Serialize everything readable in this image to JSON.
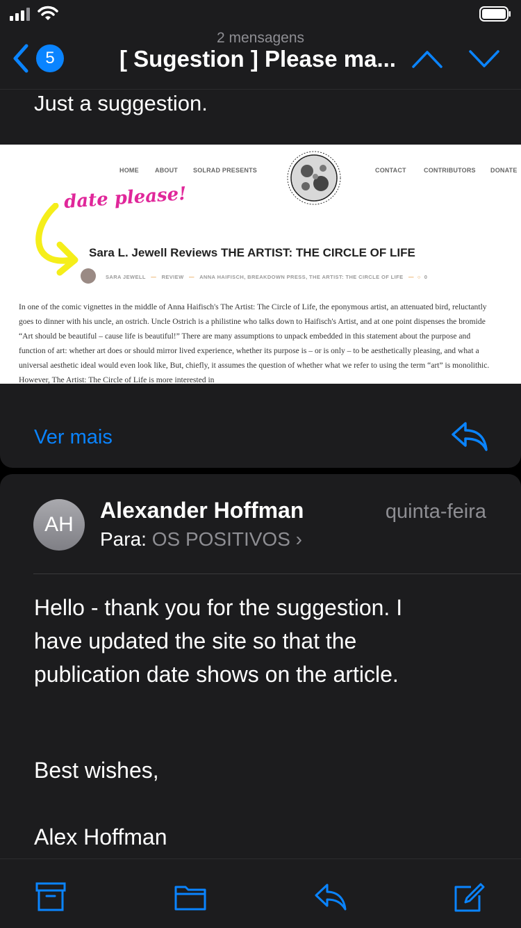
{
  "status_bar": {
    "signal_icon": "signal-icon",
    "wifi_icon": "wifi-icon",
    "battery_icon": "battery-icon"
  },
  "nav": {
    "message_count": "2 mensagens",
    "unread_badge": "5",
    "title": "[ Sugestion ] Please ma...",
    "back_icon": "chevron-left-icon",
    "prev_icon": "chevron-up-icon",
    "next_icon": "chevron-down-icon"
  },
  "first_message": {
    "text": "Just a suggestion.",
    "more_label": "Ver mais",
    "reply_icon": "reply-icon",
    "attachment": {
      "nav_items": [
        "HOME",
        "ABOUT",
        "SOLRAD PRESENTS",
        "CONTACT",
        "CONTRIBUTORS",
        "DONATE"
      ],
      "annotation": "date please!",
      "headline": "Sara L. Jewell Reviews THE ARTIST: THE CIRCLE OF LIFE",
      "meta": {
        "author": "SARA JEWELL",
        "category": "REVIEW",
        "tags": "ANNA HAIFISCH, BREAKDOWN PRESS, THE ARTIST: THE CIRCLE OF LIFE",
        "comments": "0"
      },
      "body": "In one of the comic vignettes in the middle of Anna Haifisch's The Artist: The Circle of Life, the eponymous artist, an attenuated bird, reluctantly goes to dinner with his uncle, an ostrich. Uncle Ostrich is a philistine who talks down to Haifisch's Artist, and at one point dispenses the bromide “Art should be beautiful – cause life is beautiful!” There are many assumptions to unpack embedded in this statement about the purpose and function of art: whether art does or should mirror lived experience, whether its purpose is – or is only – to be aesthetically pleasing, and what a universal aesthetic ideal would even look like, But, chiefly, it assumes the question of whether what we refer to using the term “art” is monolithic. However, The Artist: The Circle of Life is more interested in"
    }
  },
  "second_message": {
    "avatar_initials": "AH",
    "sender": "Alexander Hoffman",
    "date": "quinta-feira",
    "to_label": "Para:",
    "recipient": "OS POSITIVOS",
    "recipient_chevron": "›",
    "body": [
      "Hello - thank you for the suggestion. I",
      "have updated the site so that the",
      "publication date shows on the article."
    ],
    "greeting": "Best wishes,",
    "signature": "Alex Hoffman"
  },
  "toolbar": {
    "archive_icon": "archive-icon",
    "folder_icon": "folder-icon",
    "reply_icon": "reply-icon",
    "compose_icon": "compose-icon"
  },
  "colors": {
    "accent": "#0a84ff",
    "background": "#1c1c1e",
    "secondary_text": "#8e8e93",
    "annotation": "#e0279a",
    "highlight": "#f5ee1a"
  }
}
